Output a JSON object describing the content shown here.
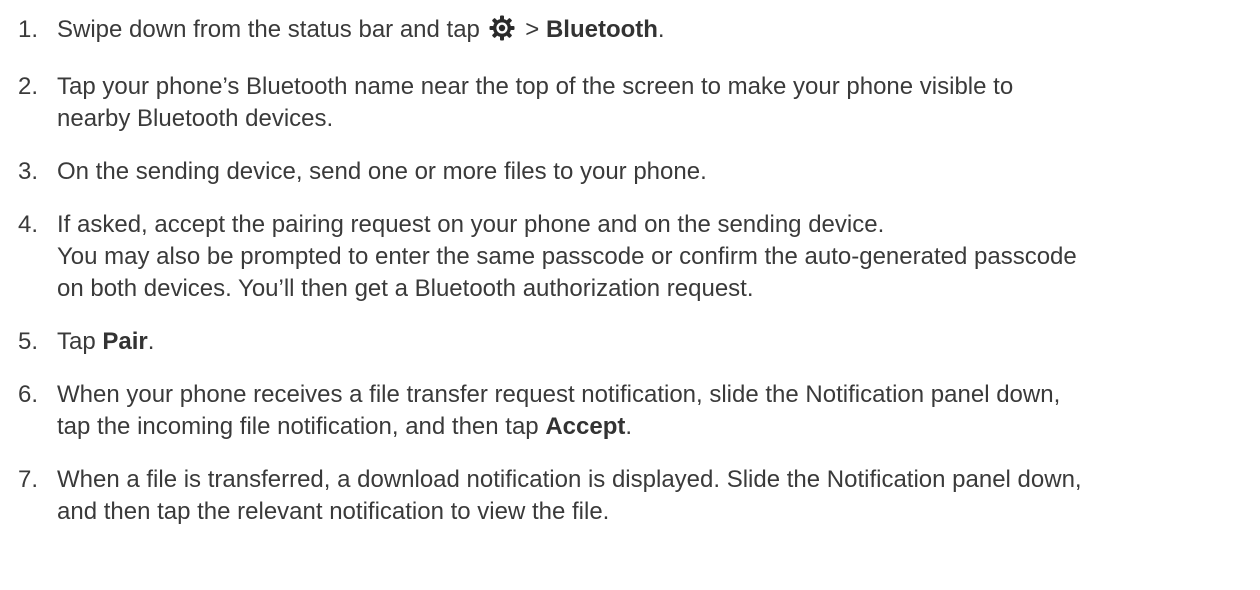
{
  "steps": [
    {
      "number": "1.",
      "text_before": "Swipe down from the status bar and tap ",
      "icon": "settings-gear-icon",
      "separator": " > ",
      "bold": "Bluetooth",
      "text_after": "."
    },
    {
      "number": "2.",
      "line1": "Tap your phone’s Bluetooth name near the top of the screen to make your phone visible to",
      "line2": "nearby Bluetooth devices."
    },
    {
      "number": "3.",
      "line1": "On the sending device, send one or more files to your phone."
    },
    {
      "number": "4.",
      "line1": "If asked, accept the pairing request on your phone and on the sending device.",
      "line2": "You may also be prompted to enter the same passcode or confirm the auto-generated passcode",
      "line3": "on both devices. You’ll then get a Bluetooth authorization request."
    },
    {
      "number": "5.",
      "text_before": "Tap ",
      "bold": "Pair",
      "text_after": "."
    },
    {
      "number": "6.",
      "line1": "When your phone receives a file transfer request notification, slide the Notification panel down,",
      "line2_before": "tap the incoming file notification, and then tap ",
      "bold": "Accept",
      "text_after": "."
    },
    {
      "number": "7.",
      "line1": "When a file is transferred, a download notification is displayed. Slide the Notification panel down,",
      "line2": "and then tap the relevant notification to view the file."
    }
  ]
}
